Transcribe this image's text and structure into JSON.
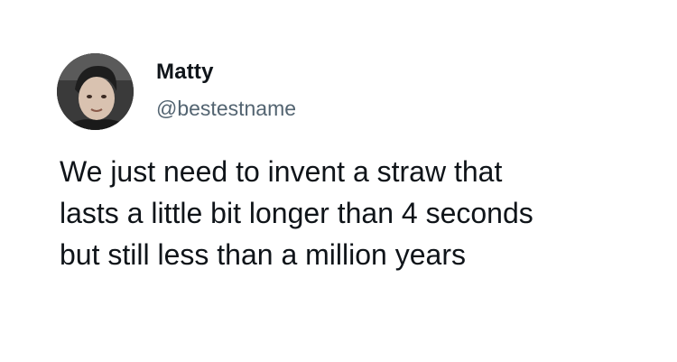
{
  "author": {
    "display_name": "Matty",
    "handle": "@bestestname",
    "avatar_icon": "profile-photo"
  },
  "tweet": {
    "lines": [
      "We just need to invent a straw that",
      "lasts a little bit longer than 4 seconds",
      "but still less than a million years"
    ]
  },
  "colors": {
    "background": "#ffffff",
    "text": "#0f1419",
    "handle": "#536471"
  }
}
